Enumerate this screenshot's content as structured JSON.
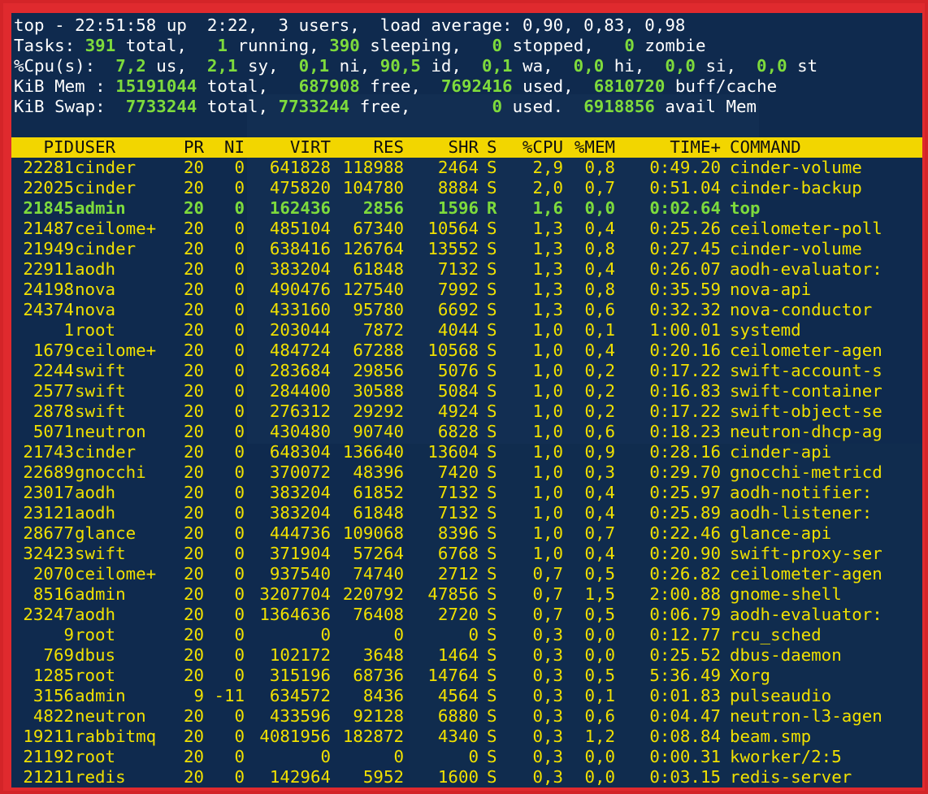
{
  "summary": {
    "line1_prefix": "top - ",
    "time": "22:51:58",
    "line1_rest": " up  2:22,  3 users,  load average: 0,90, 0,83, 0,98",
    "tasks_label": "Tasks: ",
    "tasks_total": "391",
    "tasks_total_label": " total,   ",
    "tasks_running": "1",
    "tasks_running_label": " running, ",
    "tasks_sleeping": "390",
    "tasks_sleeping_label": " sleeping,   ",
    "tasks_stopped": "0",
    "tasks_stopped_label": " stopped,   ",
    "tasks_zombie": "0",
    "tasks_zombie_label": " zombie",
    "cpu_label": "%Cpu(s):  ",
    "cpu_us": "7,2",
    "cpu_us_label": " us,  ",
    "cpu_sy": "2,1",
    "cpu_sy_label": " sy,  ",
    "cpu_ni": "0,1",
    "cpu_ni_label": " ni, ",
    "cpu_id": "90,5",
    "cpu_id_label": " id,  ",
    "cpu_wa": "0,1",
    "cpu_wa_label": " wa,  ",
    "cpu_hi": "0,0",
    "cpu_hi_label": " hi,  ",
    "cpu_si": "0,0",
    "cpu_si_label": " si,  ",
    "cpu_st": "0,0",
    "cpu_st_label": " st",
    "mem_label": "KiB Mem : ",
    "mem_total": "15191044",
    "mem_total_label": " total,   ",
    "mem_free": "687908",
    "mem_free_label": " free,  ",
    "mem_used": "7692416",
    "mem_used_label": " used,  ",
    "mem_cache": "6810720",
    "mem_cache_label": " buff/cache",
    "swap_label": "KiB Swap:  ",
    "swap_total": "7733244",
    "swap_total_label": " total, ",
    "swap_free": "7733244",
    "swap_free_label": " free,        ",
    "swap_used": "0",
    "swap_used_label": " used.  ",
    "swap_avail": "6918856",
    "swap_avail_label": " avail Mem"
  },
  "columns": [
    "PID",
    "USER",
    "PR",
    "NI",
    "VIRT",
    "RES",
    "SHR",
    "S",
    "%CPU",
    "%MEM",
    "TIME+",
    "COMMAND"
  ],
  "processes": [
    [
      "22281",
      "cinder",
      "20",
      "0",
      "641828",
      "118988",
      "2464",
      "S",
      "2,9",
      "0,8",
      "0:49.20",
      "cinder-volume"
    ],
    [
      "22025",
      "cinder",
      "20",
      "0",
      "475820",
      "104780",
      "8884",
      "S",
      "2,0",
      "0,7",
      "0:51.04",
      "cinder-backup"
    ],
    [
      "21845",
      "admin",
      "20",
      "0",
      "162436",
      "2856",
      "1596",
      "R",
      "1,6",
      "0,0",
      "0:02.64",
      "top"
    ],
    [
      "21487",
      "ceilome+",
      "20",
      "0",
      "485104",
      "67340",
      "10564",
      "S",
      "1,3",
      "0,4",
      "0:25.26",
      "ceilometer-poll"
    ],
    [
      "21949",
      "cinder",
      "20",
      "0",
      "638416",
      "126764",
      "13552",
      "S",
      "1,3",
      "0,8",
      "0:27.45",
      "cinder-volume"
    ],
    [
      "22911",
      "aodh",
      "20",
      "0",
      "383204",
      "61848",
      "7132",
      "S",
      "1,3",
      "0,4",
      "0:26.07",
      "aodh-evaluator:"
    ],
    [
      "24198",
      "nova",
      "20",
      "0",
      "490476",
      "127540",
      "7992",
      "S",
      "1,3",
      "0,8",
      "0:35.59",
      "nova-api"
    ],
    [
      "24374",
      "nova",
      "20",
      "0",
      "433160",
      "95780",
      "6692",
      "S",
      "1,3",
      "0,6",
      "0:32.32",
      "nova-conductor"
    ],
    [
      "1",
      "root",
      "20",
      "0",
      "203044",
      "7872",
      "4044",
      "S",
      "1,0",
      "0,1",
      "1:00.01",
      "systemd"
    ],
    [
      "1679",
      "ceilome+",
      "20",
      "0",
      "484724",
      "67288",
      "10568",
      "S",
      "1,0",
      "0,4",
      "0:20.16",
      "ceilometer-agen"
    ],
    [
      "2244",
      "swift",
      "20",
      "0",
      "283684",
      "29856",
      "5076",
      "S",
      "1,0",
      "0,2",
      "0:17.22",
      "swift-account-s"
    ],
    [
      "2577",
      "swift",
      "20",
      "0",
      "284400",
      "30588",
      "5084",
      "S",
      "1,0",
      "0,2",
      "0:16.83",
      "swift-container"
    ],
    [
      "2878",
      "swift",
      "20",
      "0",
      "276312",
      "29292",
      "4924",
      "S",
      "1,0",
      "0,2",
      "0:17.22",
      "swift-object-se"
    ],
    [
      "5071",
      "neutron",
      "20",
      "0",
      "430480",
      "90740",
      "6828",
      "S",
      "1,0",
      "0,6",
      "0:18.23",
      "neutron-dhcp-ag"
    ],
    [
      "21743",
      "cinder",
      "20",
      "0",
      "648304",
      "136640",
      "13604",
      "S",
      "1,0",
      "0,9",
      "0:28.16",
      "cinder-api"
    ],
    [
      "22689",
      "gnocchi",
      "20",
      "0",
      "370072",
      "48396",
      "7420",
      "S",
      "1,0",
      "0,3",
      "0:29.70",
      "gnocchi-metricd"
    ],
    [
      "23017",
      "aodh",
      "20",
      "0",
      "383204",
      "61852",
      "7132",
      "S",
      "1,0",
      "0,4",
      "0:25.97",
      "aodh-notifier:"
    ],
    [
      "23121",
      "aodh",
      "20",
      "0",
      "383204",
      "61848",
      "7132",
      "S",
      "1,0",
      "0,4",
      "0:25.89",
      "aodh-listener:"
    ],
    [
      "28677",
      "glance",
      "20",
      "0",
      "444736",
      "109068",
      "8396",
      "S",
      "1,0",
      "0,7",
      "0:22.46",
      "glance-api"
    ],
    [
      "32423",
      "swift",
      "20",
      "0",
      "371904",
      "57264",
      "6768",
      "S",
      "1,0",
      "0,4",
      "0:20.90",
      "swift-proxy-ser"
    ],
    [
      "2070",
      "ceilome+",
      "20",
      "0",
      "937540",
      "74740",
      "2712",
      "S",
      "0,7",
      "0,5",
      "0:26.82",
      "ceilometer-agen"
    ],
    [
      "8516",
      "admin",
      "20",
      "0",
      "3207704",
      "220792",
      "47856",
      "S",
      "0,7",
      "1,5",
      "2:00.88",
      "gnome-shell"
    ],
    [
      "23247",
      "aodh",
      "20",
      "0",
      "1364636",
      "76408",
      "2720",
      "S",
      "0,7",
      "0,5",
      "0:06.79",
      "aodh-evaluator:"
    ],
    [
      "9",
      "root",
      "20",
      "0",
      "0",
      "0",
      "0",
      "S",
      "0,3",
      "0,0",
      "0:12.77",
      "rcu_sched"
    ],
    [
      "769",
      "dbus",
      "20",
      "0",
      "102172",
      "3648",
      "1464",
      "S",
      "0,3",
      "0,0",
      "0:25.52",
      "dbus-daemon"
    ],
    [
      "1285",
      "root",
      "20",
      "0",
      "315196",
      "68736",
      "14764",
      "S",
      "0,3",
      "0,5",
      "5:36.49",
      "Xorg"
    ],
    [
      "3156",
      "admin",
      "9",
      "-11",
      "634572",
      "8436",
      "4564",
      "S",
      "0,3",
      "0,1",
      "0:01.83",
      "pulseaudio"
    ],
    [
      "4822",
      "neutron",
      "20",
      "0",
      "433596",
      "92128",
      "6880",
      "S",
      "0,3",
      "0,6",
      "0:04.47",
      "neutron-l3-agen"
    ],
    [
      "19211",
      "rabbitmq",
      "20",
      "0",
      "4081956",
      "182872",
      "4340",
      "S",
      "0,3",
      "1,2",
      "0:08.84",
      "beam.smp"
    ],
    [
      "21192",
      "root",
      "20",
      "0",
      "0",
      "0",
      "0",
      "S",
      "0,3",
      "0,0",
      "0:00.31",
      "kworker/2:5"
    ],
    [
      "21211",
      "redis",
      "20",
      "0",
      "142964",
      "5952",
      "1600",
      "S",
      "0,3",
      "0,0",
      "0:03.15",
      "redis-server"
    ]
  ],
  "active_pid": "21845"
}
